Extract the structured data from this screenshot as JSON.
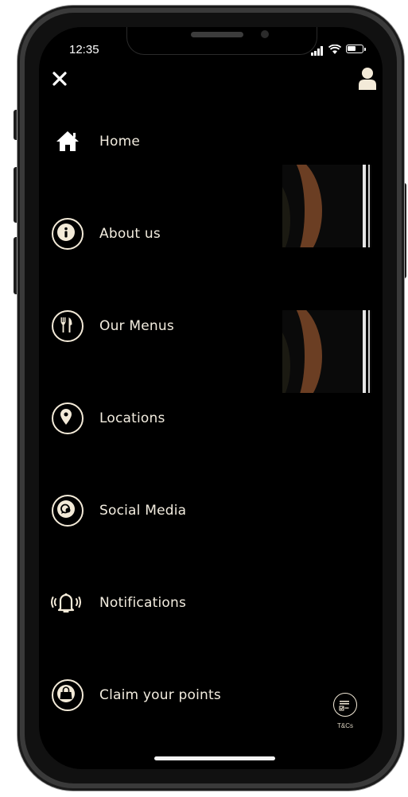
{
  "status_bar": {
    "time": "12:35"
  },
  "menu": {
    "items": [
      {
        "label": "Home",
        "icon": "home-icon"
      },
      {
        "label": "About us",
        "icon": "info-icon"
      },
      {
        "label": "Our Menus",
        "icon": "utensils-icon"
      },
      {
        "label": "Locations",
        "icon": "map-pin-icon"
      },
      {
        "label": "Social Media",
        "icon": "chat-bubble-icon"
      },
      {
        "label": "Notifications",
        "icon": "bell-ringing-icon"
      },
      {
        "label": "Claim your points",
        "icon": "shopping-bag-icon"
      }
    ]
  },
  "footer": {
    "tacs_label": "T&Cs"
  },
  "colors": {
    "background": "#000000",
    "accent": "#f3ead8",
    "text": "#f2ecdf"
  }
}
